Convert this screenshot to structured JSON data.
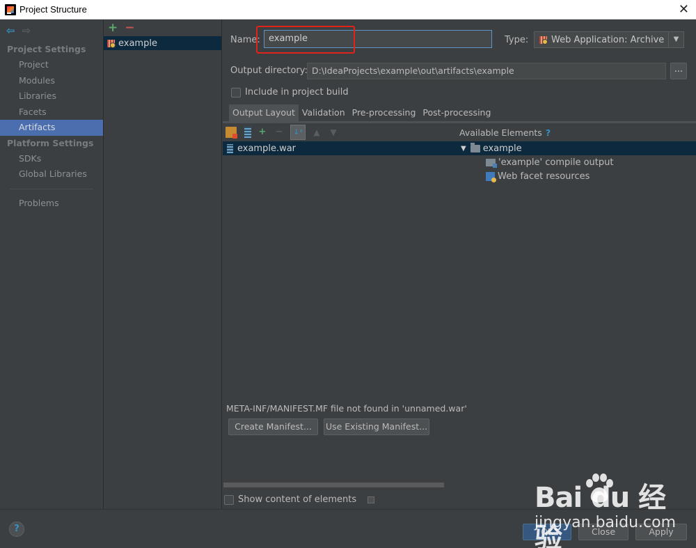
{
  "window": {
    "title": "Project Structure"
  },
  "nav": {
    "sections": [
      {
        "title": "Project Settings",
        "items": [
          "Project",
          "Modules",
          "Libraries",
          "Facets",
          "Artifacts"
        ]
      },
      {
        "title": "Platform Settings",
        "items": [
          "SDKs",
          "Global Libraries"
        ]
      }
    ],
    "problems": "Problems",
    "selected": "Artifacts"
  },
  "artifacts": {
    "items": [
      "example"
    ]
  },
  "form": {
    "name_label": "Name:",
    "name_value": "example",
    "type_label": "Type:",
    "type_value": "Web Application: Archive",
    "outdir_label": "Output directory:",
    "outdir_value": "D:\\IdeaProjects\\example\\out\\artifacts\\example",
    "browse": "...",
    "include_label": "Include in project build"
  },
  "tabs": [
    "Output Layout",
    "Validation",
    "Pre-processing",
    "Post-processing"
  ],
  "layout": {
    "root_item": "example.war",
    "manifest_msg": "META-INF/MANIFEST.MF file not found in 'unnamed.war'",
    "create_manifest": "Create Manifest...",
    "use_existing_manifest": "Use Existing Manifest...",
    "show_content": "Show content of elements"
  },
  "available": {
    "title": "Available Elements",
    "help": "?",
    "root": "example",
    "children": [
      "'example' compile output",
      "Web facet resources"
    ]
  },
  "footer": {
    "help": "?",
    "ok": "OK",
    "close": "Close",
    "apply": "Apply"
  },
  "watermark": {
    "brand": "Bai du 经验",
    "url": "jingyan.baidu.com"
  },
  "colors": {
    "selection": "#4b6eaf",
    "tree_selection": "#0d293e",
    "highlight": "#e2231a",
    "accent": "#3592c4"
  }
}
